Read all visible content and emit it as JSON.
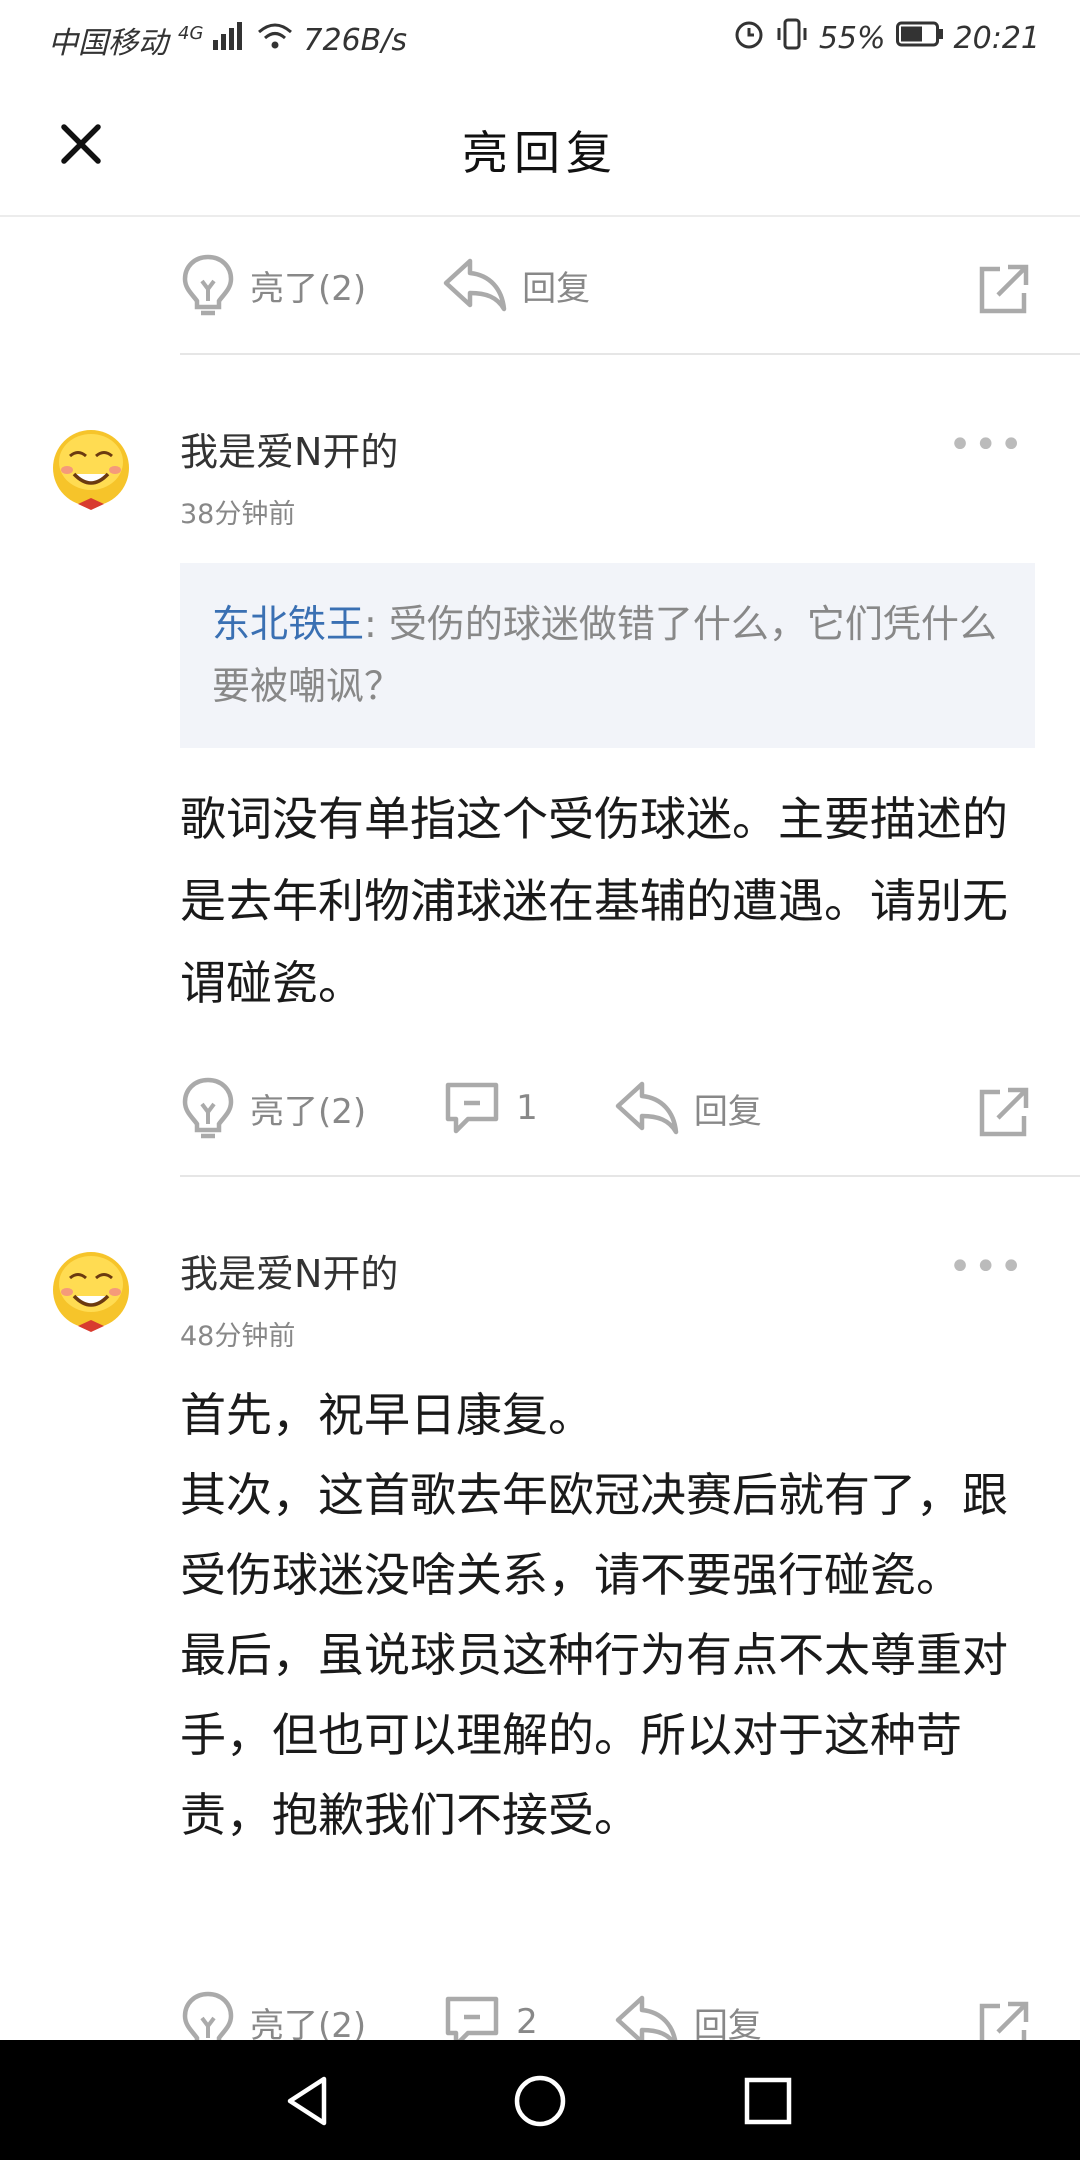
{
  "status_bar": {
    "carrier": "中国移动",
    "network": "4G",
    "speed": "726B/s",
    "battery": "55%",
    "time": "20:21"
  },
  "header": {
    "title": "亮回复"
  },
  "actions": {
    "light_label": "亮了(2)",
    "reply_label": "回复"
  },
  "comments": [
    {
      "username": "我是爱N开的",
      "time": "38分钟前",
      "quote": {
        "author": "东北铁王",
        "separator": ": ",
        "text": "受伤的球迷做错了什么，它们凭什么要被嘲讽？"
      },
      "body": "歌词没有单指这个受伤球迷。主要描述的是去年利物浦球迷在基辅的遭遇。请别无谓碰瓷。",
      "comment_count": "1"
    },
    {
      "username": "我是爱N开的",
      "time": "48分钟前",
      "body_lines": [
        "首先，祝早日康复。",
        "其次，这首歌去年欧冠决赛后就有了，跟受伤球迷没啥关系，请不要强行碰瓷。",
        "最后，虽说球员这种行为有点不太尊重对手，但也可以理解的。所以对于这种苛责，抱歉我们不接受。"
      ],
      "comment_count": "2"
    }
  ],
  "icons": {
    "close": "close-icon",
    "light": "lightbulb-icon",
    "comment": "comment-icon",
    "reply": "reply-arrow-icon",
    "share": "share-icon",
    "more": "more-dots-icon",
    "nav_back": "triangle-back-icon",
    "nav_home": "circle-home-icon",
    "nav_recent": "square-recent-icon"
  },
  "colors": {
    "quote_author": "#3a70b3",
    "muted": "#888888",
    "quote_bg": "#f2f4f9"
  }
}
